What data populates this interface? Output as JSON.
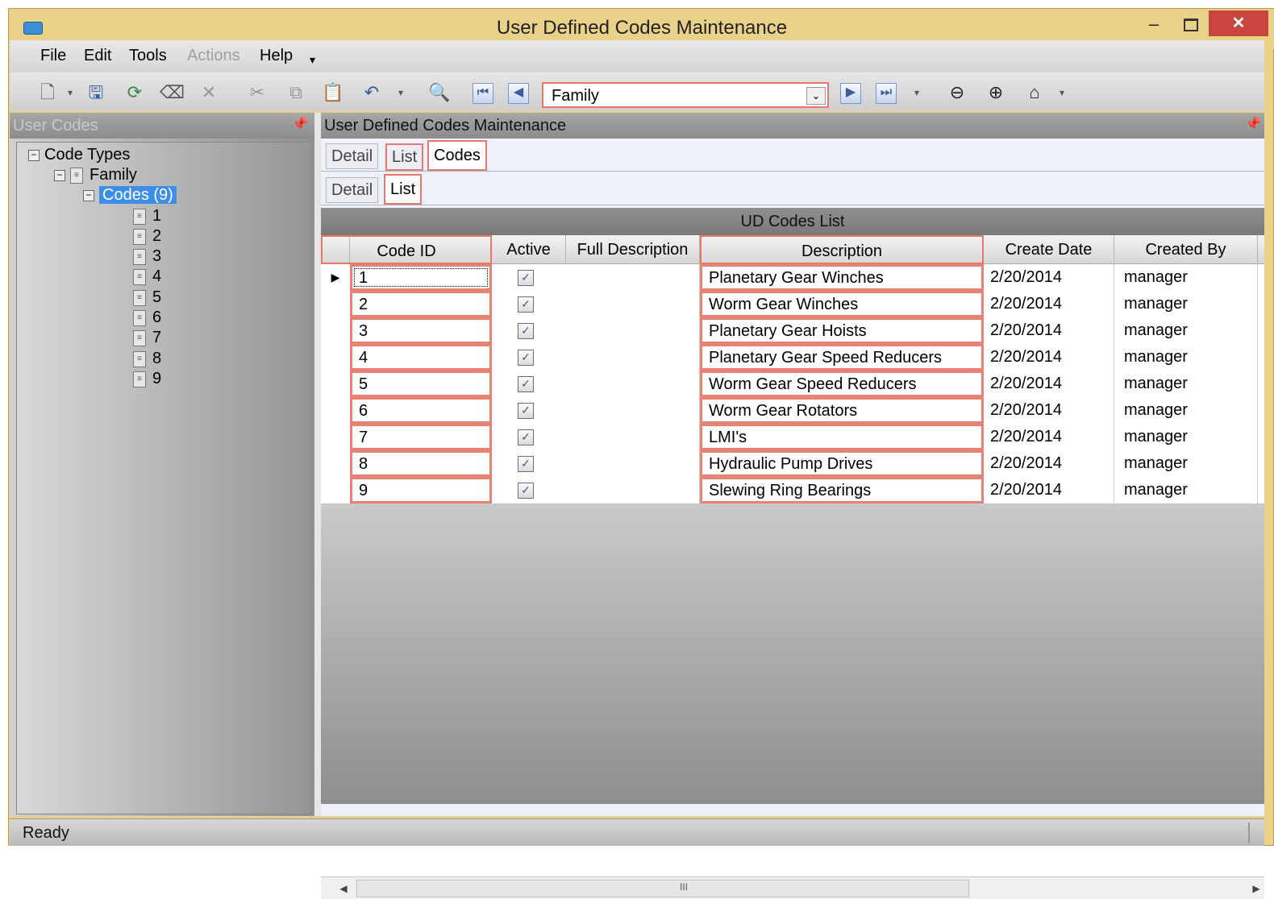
{
  "window": {
    "title": "User Defined Codes Maintenance",
    "minimize": "–",
    "close": "✕"
  },
  "menu": [
    "File",
    "Edit",
    "Tools",
    "Actions",
    "Help"
  ],
  "toolbar": {
    "combo_value": "Family",
    "dropdown_glyph": "⌄"
  },
  "left_pane": {
    "title": "User Codes",
    "tree": {
      "root": "Code Types",
      "family": "Family",
      "codes": "Codes (9)",
      "items": [
        "1",
        "2",
        "3",
        "4",
        "5",
        "6",
        "7",
        "8",
        "9"
      ]
    }
  },
  "right_pane": {
    "title": "User Defined Codes Maintenance",
    "top_tabs": [
      "Detail",
      "List",
      "Codes"
    ],
    "sub_tabs": [
      "Detail",
      "List"
    ]
  },
  "grid": {
    "caption": "UD Codes List",
    "columns": [
      "Code ID",
      "Active",
      "Full Description",
      "Description",
      "Create Date",
      "Created By"
    ],
    "rows": [
      {
        "code_id": "1",
        "active": true,
        "full_description": "",
        "description": "Planetary Gear Winches",
        "create_date": "2/20/2014",
        "created_by": "manager"
      },
      {
        "code_id": "2",
        "active": true,
        "full_description": "",
        "description": "Worm Gear Winches",
        "create_date": "2/20/2014",
        "created_by": "manager"
      },
      {
        "code_id": "3",
        "active": true,
        "full_description": "",
        "description": "Planetary Gear Hoists",
        "create_date": "2/20/2014",
        "created_by": "manager"
      },
      {
        "code_id": "4",
        "active": true,
        "full_description": "",
        "description": "Planetary Gear Speed Reducers",
        "create_date": "2/20/2014",
        "created_by": "manager"
      },
      {
        "code_id": "5",
        "active": true,
        "full_description": "",
        "description": "Worm Gear Speed Reducers",
        "create_date": "2/20/2014",
        "created_by": "manager"
      },
      {
        "code_id": "6",
        "active": true,
        "full_description": "",
        "description": "Worm Gear Rotators",
        "create_date": "2/20/2014",
        "created_by": "manager"
      },
      {
        "code_id": "7",
        "active": true,
        "full_description": "",
        "description": "LMI's",
        "create_date": "2/20/2014",
        "created_by": "manager"
      },
      {
        "code_id": "8",
        "active": true,
        "full_description": "",
        "description": "Hydraulic Pump Drives",
        "create_date": "2/20/2014",
        "created_by": "manager"
      },
      {
        "code_id": "9",
        "active": true,
        "full_description": "",
        "description": "Slewing Ring Bearings",
        "create_date": "2/20/2014",
        "created_by": "manager"
      }
    ],
    "scroll_grip": "III"
  },
  "status": {
    "text": "Ready"
  },
  "colors": {
    "title_bar": "#e9d18a",
    "highlight_border": "#e3786b",
    "selection": "#3d8ee6",
    "close_button": "#c9453d"
  }
}
